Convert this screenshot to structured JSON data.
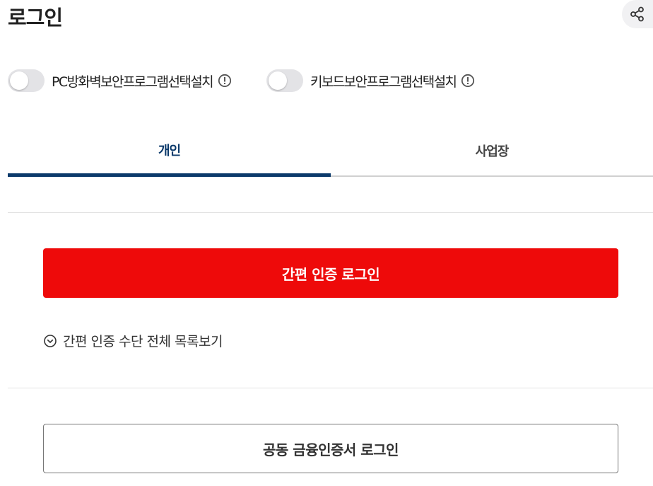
{
  "page": {
    "title": "로그인"
  },
  "header": {
    "share_icon": "share-icon"
  },
  "security_toggles": [
    {
      "label": "PC방화벽보안프로그램선택설치",
      "enabled": false,
      "icon": "info-circle-icon"
    },
    {
      "label": "키보드보안프로그램선택설치",
      "enabled": false,
      "icon": "info-circle-icon"
    }
  ],
  "tabs": [
    {
      "label": "개인",
      "active": true
    },
    {
      "label": "사업장",
      "active": false
    }
  ],
  "actions": {
    "easy_login": "간편 인증 로그인",
    "view_all_methods": "간편 인증 수단 전체 목록보기",
    "certificate_login": "공동 금융인증서 로그인"
  },
  "colors": {
    "accent_red": "#ee0a0a",
    "tab_active": "#0c3a6b"
  }
}
